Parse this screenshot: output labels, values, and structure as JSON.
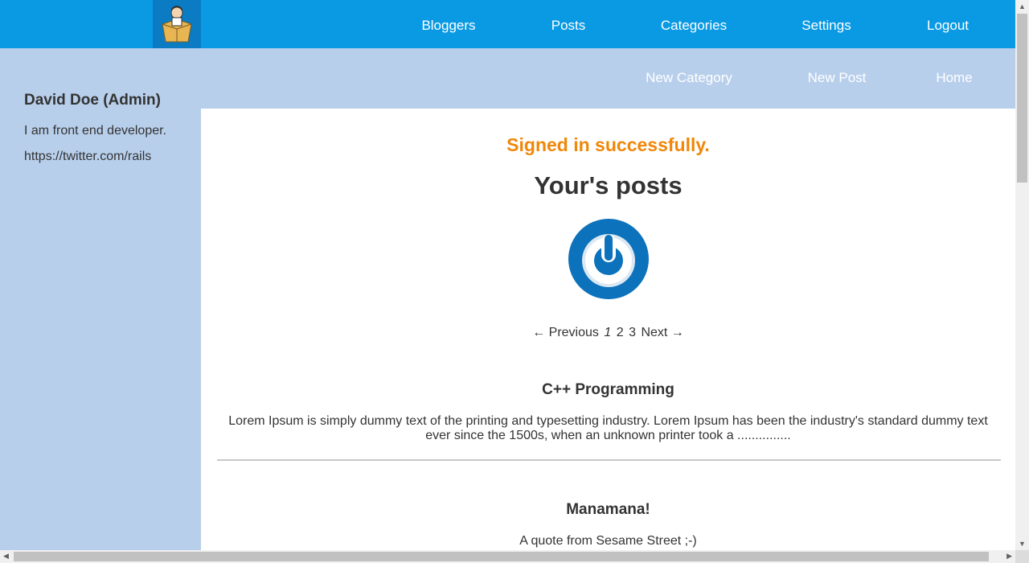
{
  "nav": {
    "bloggers": "Bloggers",
    "posts": "Posts",
    "categories": "Categories",
    "settings": "Settings",
    "logout": "Logout"
  },
  "subnav": {
    "new_category": "New Category",
    "new_post": "New Post",
    "home": "Home"
  },
  "sidebar": {
    "name": "David Doe (Admin)",
    "bio": "I am front end developer.",
    "link": "https://twitter.com/rails"
  },
  "main": {
    "flash": "Signed in successfully.",
    "heading": "Your's posts",
    "pager": {
      "previous": "← Previous",
      "page1": "1",
      "page2": "2",
      "page3": "3",
      "next": "Next →"
    },
    "posts": [
      {
        "title": "C++ Programming",
        "excerpt": "Lorem Ipsum is simply dummy text of the printing and typesetting industry. Lorem Ipsum has been the industry's standard dummy text ever since the 1500s, when an unknown printer took a ..............."
      },
      {
        "title": "Manamana!",
        "excerpt": "A quote from Sesame Street ;-)"
      }
    ]
  },
  "colors": {
    "topbar": "#0a9ae4",
    "background": "#b8cfec",
    "flash": "#f0870a",
    "power_icon": "#0b72bb"
  },
  "icons": {
    "logo": "blogger-mascot-logo",
    "avatar": "power-icon"
  }
}
